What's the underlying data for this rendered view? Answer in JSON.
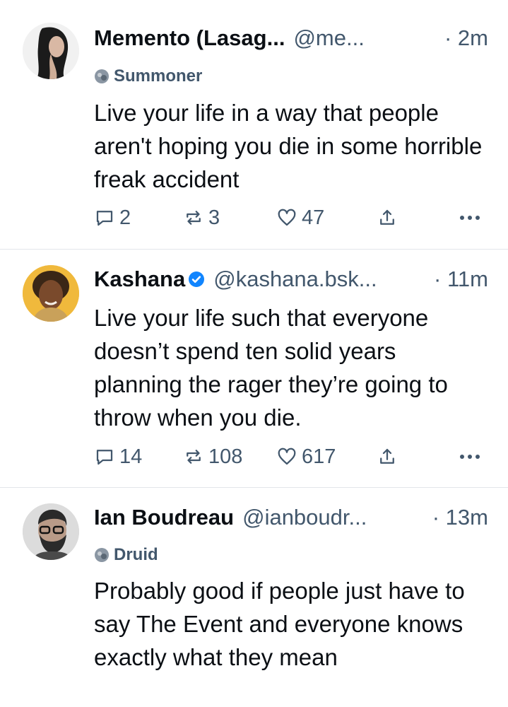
{
  "posts": [
    {
      "display_name": "Memento (Lasag...",
      "handle": "@me...",
      "time": "· 2m",
      "verified": false,
      "badge": "Summoner",
      "text": "Live your life in a way that people aren't hoping you die in some horrible freak accident",
      "replies": "2",
      "reposts": "3",
      "likes": "47",
      "avatar_icon": "avatar-woman-icon"
    },
    {
      "display_name": "Kashana",
      "handle": "@kashana.bsk...",
      "time": "· 11m",
      "verified": true,
      "badge": "",
      "text": "Live your life such that everyone doesn’t spend ten solid years planning the rager they’re going to throw when you die.",
      "replies": "14",
      "reposts": "108",
      "likes": "617",
      "avatar_icon": "avatar-woman-icon"
    },
    {
      "display_name": "Ian Boudreau",
      "handle": "@ianboudr...",
      "time": "· 13m",
      "verified": false,
      "badge": "Druid",
      "text": "Probably good if people just have to say The Event and everyone knows exactly what they mean",
      "avatar_icon": "avatar-man-icon"
    }
  ],
  "colors": {
    "text": "#0b0f14",
    "muted": "#42576c",
    "verified": "#1185fe",
    "divider": "#e3e6ea"
  }
}
